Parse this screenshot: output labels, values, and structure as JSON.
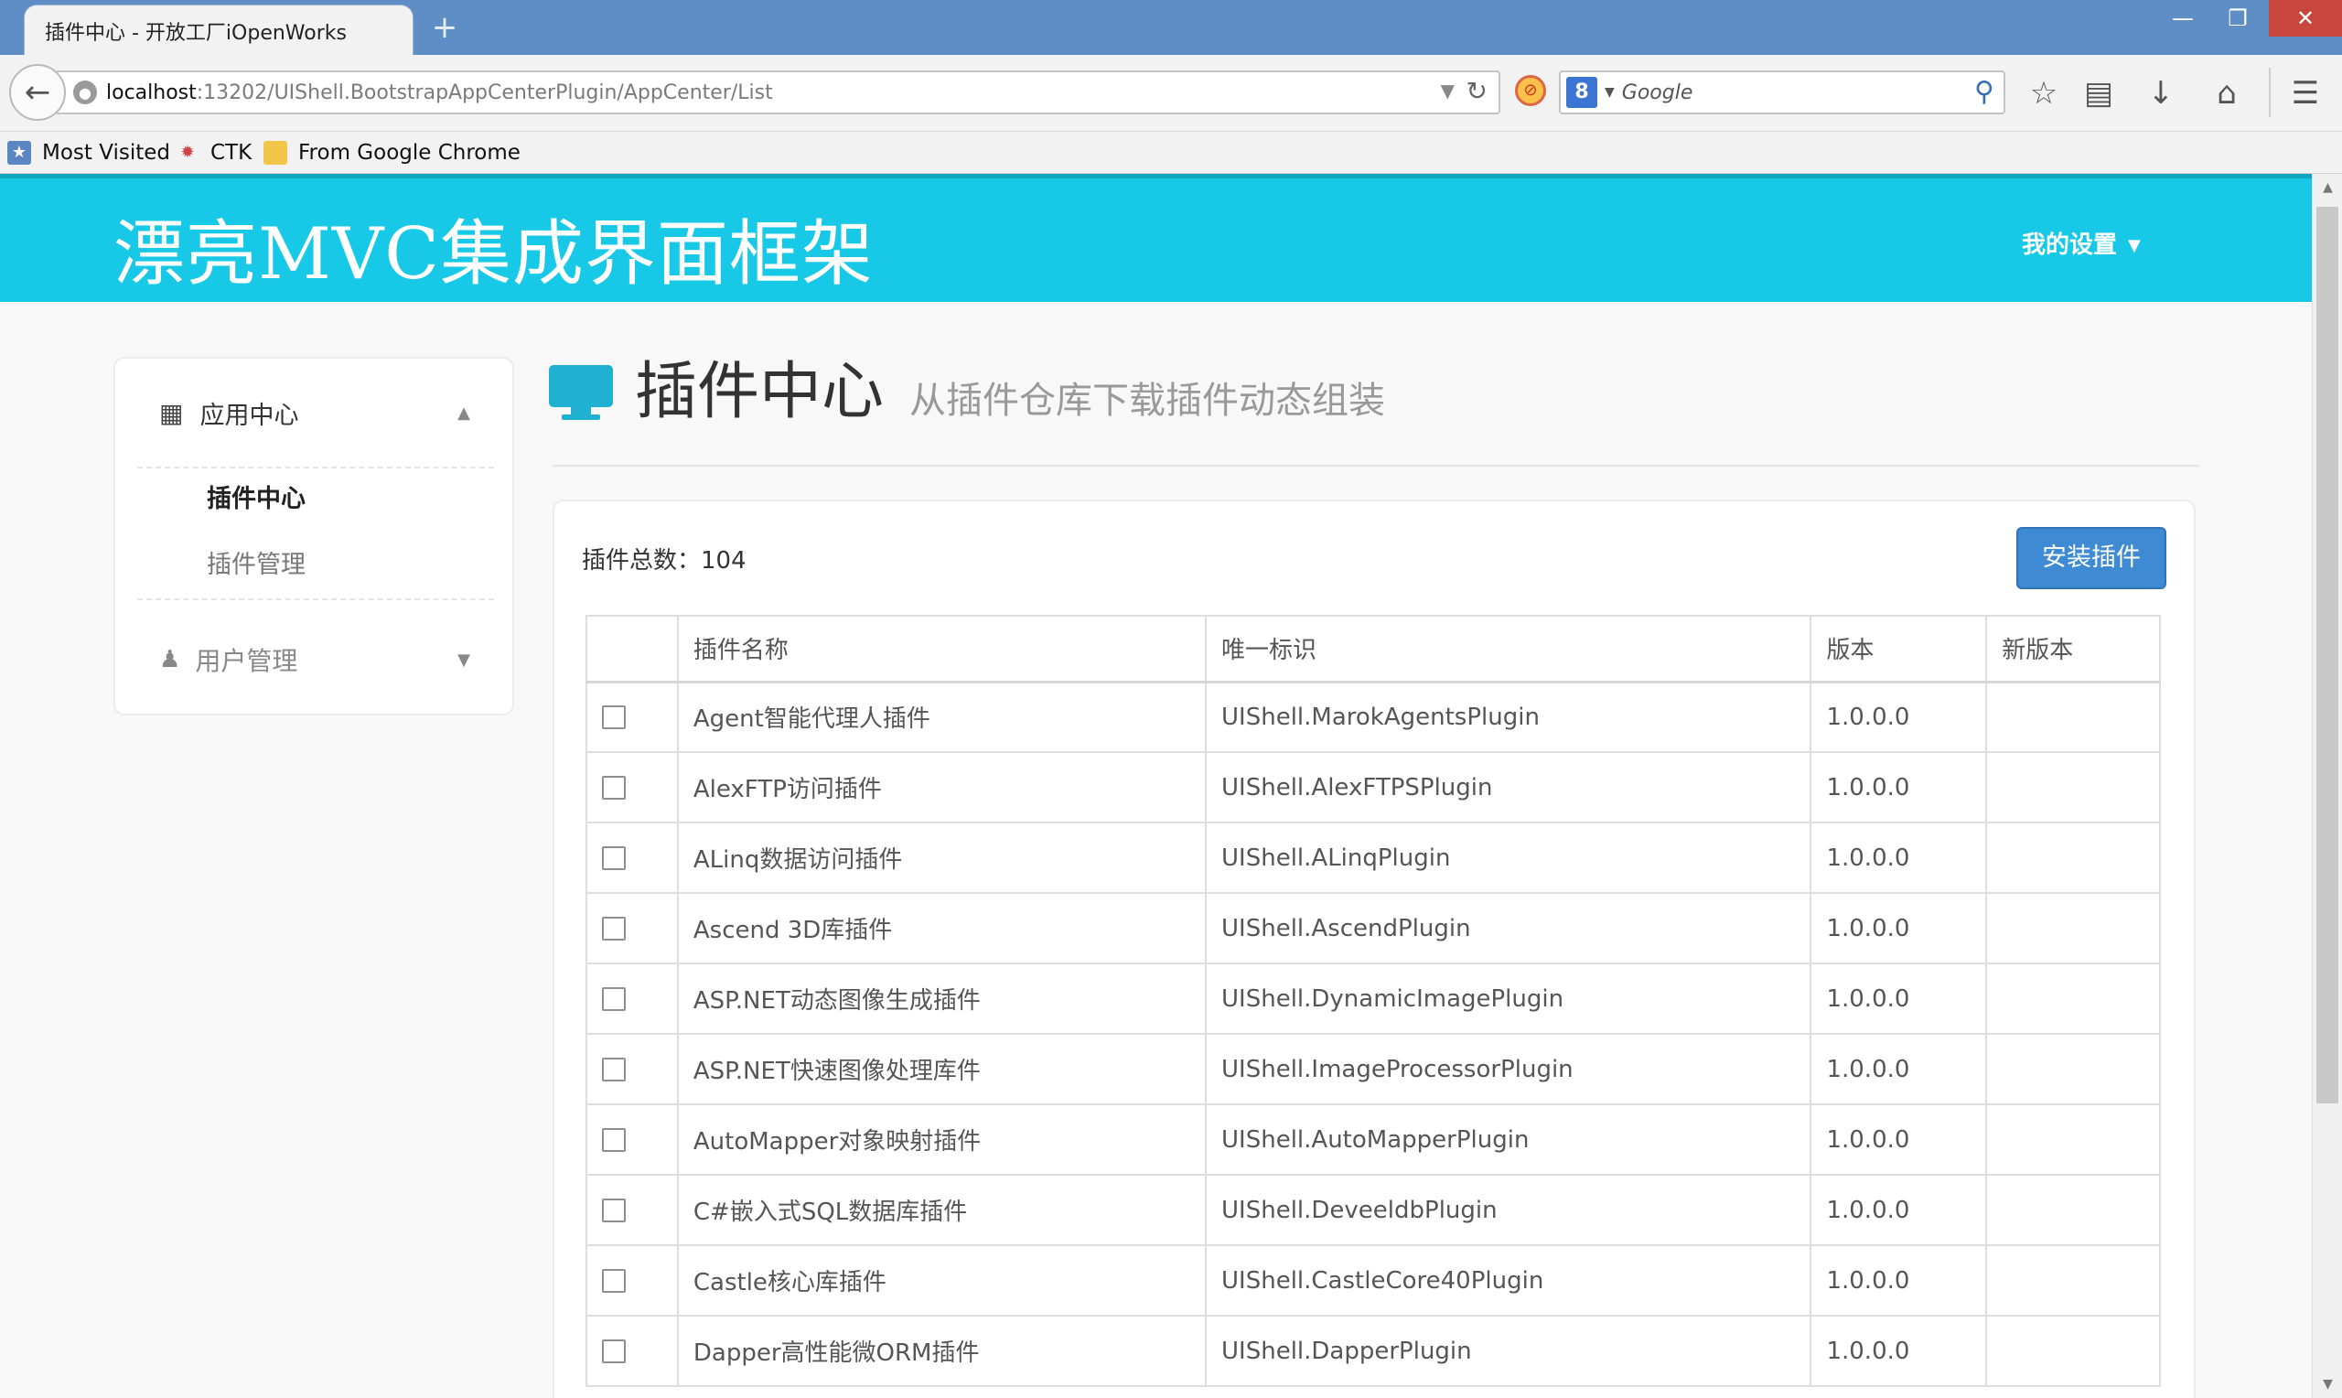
{
  "browser": {
    "tab_title": "插件中心 - 开放工厂iOpenWorks",
    "new_tab": "+",
    "url_host": "localhost",
    "url_rest": ":13202/UIShell.BootstrapAppCenterPlugin/AppCenter/List",
    "search_placeholder": "Google",
    "bookmarks": [
      {
        "label": "Most Visited",
        "icon": "most-visited-icon"
      },
      {
        "label": "CTK",
        "icon": "ctk-icon"
      },
      {
        "label": "From Google Chrome",
        "icon": "folder-icon"
      }
    ]
  },
  "header": {
    "brand": "漂亮MVC集成界面框架",
    "settings": "我的设置"
  },
  "sidebar": {
    "group_title": "应用中心",
    "items": [
      {
        "label": "插件中心",
        "active": true
      },
      {
        "label": "插件管理",
        "active": false
      }
    ],
    "user_group": "用户管理"
  },
  "page": {
    "title": "插件中心",
    "subtitle": "从插件仓库下载插件动态组装"
  },
  "panel": {
    "total_label": "插件总数：104",
    "install_button": "安装插件"
  },
  "table": {
    "headers": [
      "插件名称",
      "唯一标识",
      "版本",
      "新版本"
    ],
    "rows": [
      {
        "name": "Agent智能代理人插件",
        "id": "UIShell.MarokAgentsPlugin",
        "version": "1.0.0.0",
        "new": ""
      },
      {
        "name": "AlexFTP访问插件",
        "id": "UIShell.AlexFTPSPlugin",
        "version": "1.0.0.0",
        "new": ""
      },
      {
        "name": "ALinq数据访问插件",
        "id": "UIShell.ALinqPlugin",
        "version": "1.0.0.0",
        "new": ""
      },
      {
        "name": "Ascend 3D库插件",
        "id": "UIShell.AscendPlugin",
        "version": "1.0.0.0",
        "new": ""
      },
      {
        "name": "ASP.NET动态图像生成插件",
        "id": "UIShell.DynamicImagePlugin",
        "version": "1.0.0.0",
        "new": ""
      },
      {
        "name": "ASP.NET快速图像处理库件",
        "id": "UIShell.ImageProcessorPlugin",
        "version": "1.0.0.0",
        "new": ""
      },
      {
        "name": "AutoMapper对象映射插件",
        "id": "UIShell.AutoMapperPlugin",
        "version": "1.0.0.0",
        "new": ""
      },
      {
        "name": "C#嵌入式SQL数据库插件",
        "id": "UIShell.DeveeldbPlugin",
        "version": "1.0.0.0",
        "new": ""
      },
      {
        "name": "Castle核心库插件",
        "id": "UIShell.CastleCore40Plugin",
        "version": "1.0.0.0",
        "new": ""
      },
      {
        "name": "Dapper高性能微ORM插件",
        "id": "UIShell.DapperPlugin",
        "version": "1.0.0.0",
        "new": ""
      }
    ]
  },
  "colors": {
    "header_bg": "#17c9e6",
    "primary_button": "#3f8bd3",
    "browser_title": "#5f8ec7"
  }
}
